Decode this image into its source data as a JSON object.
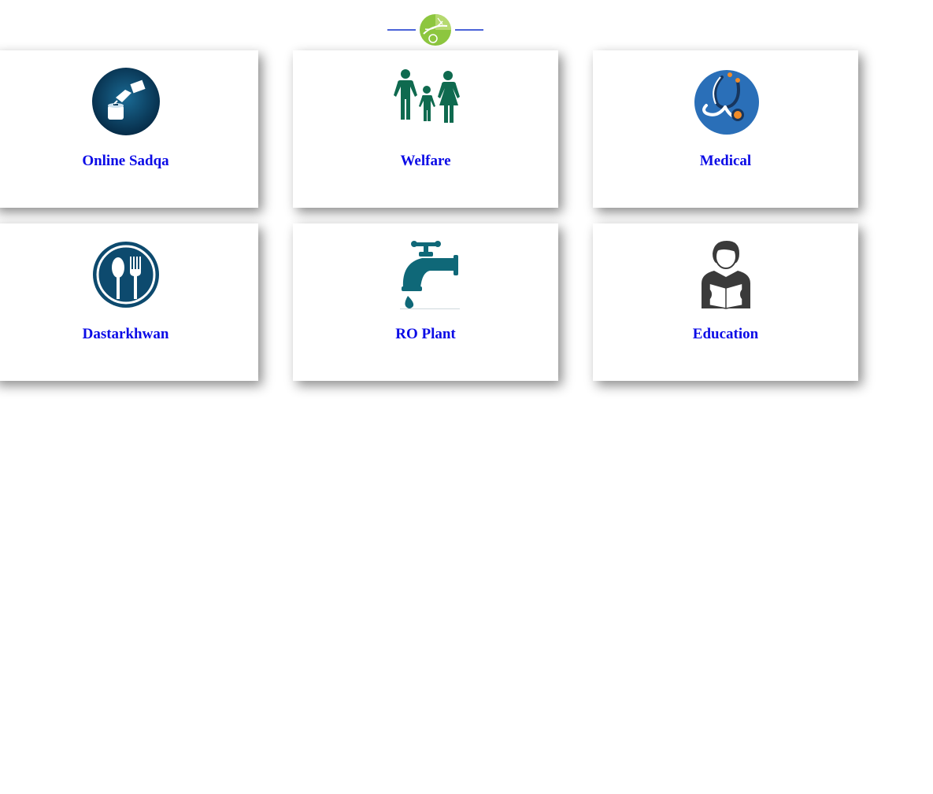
{
  "header": {
    "logo_icon": "green-leaf-logo-icon",
    "line_color": "#4a63d8"
  },
  "services": [
    {
      "label": "Online Sadqa",
      "icon": "donation-icon"
    },
    {
      "label": "Welfare",
      "icon": "family-icon"
    },
    {
      "label": "Medical",
      "icon": "stethoscope-icon"
    },
    {
      "label": "Dastarkhwan",
      "icon": "spoon-fork-icon"
    },
    {
      "label": "RO Plant",
      "icon": "water-tap-icon"
    },
    {
      "label": "Education",
      "icon": "reading-person-icon"
    }
  ],
  "colors": {
    "label": "#0b0be6",
    "donation": "#0a3d5e",
    "welfare": "#0f6a4f",
    "medical": "#2a6fb8",
    "dastarkhwan": "#0d4a6e",
    "ro_plant": "#0f6878",
    "education": "#3a3a3a"
  }
}
